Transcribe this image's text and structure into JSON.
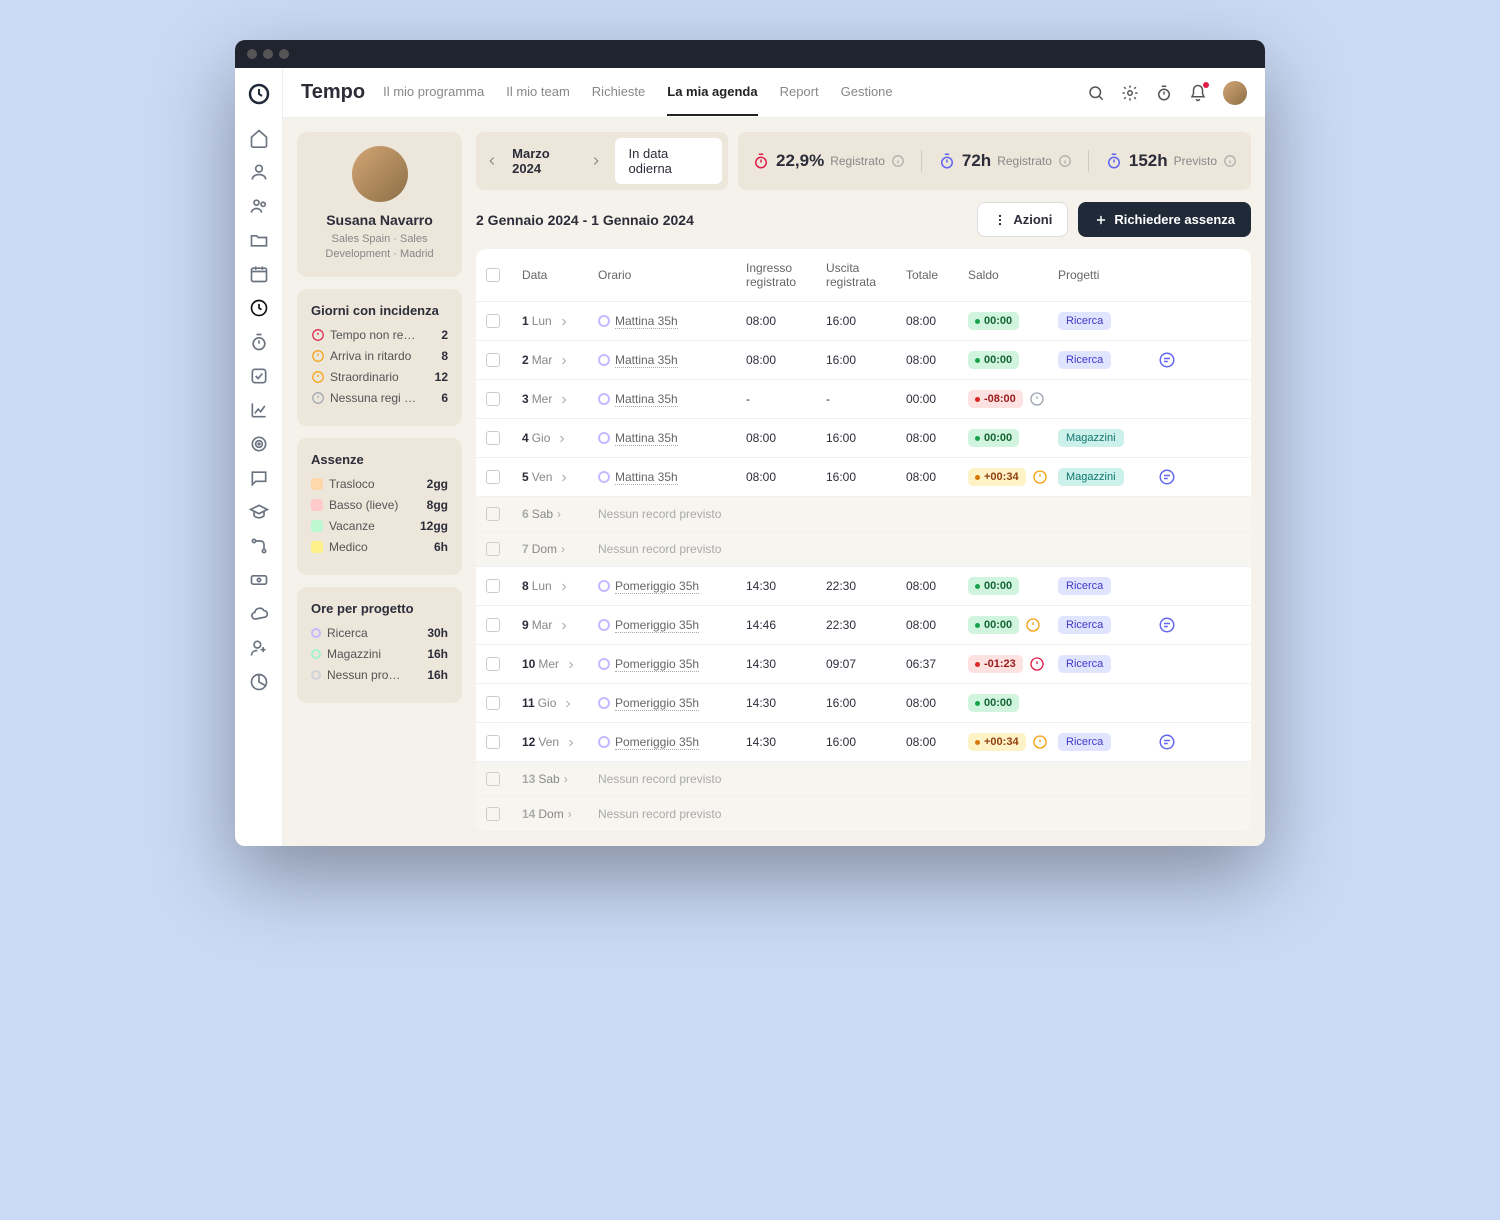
{
  "header": {
    "title": "Tempo",
    "tabs": [
      "Il mio programma",
      "Il mio team",
      "Richieste",
      "La mia agenda",
      "Report",
      "Gestione"
    ],
    "active_tab": 3
  },
  "date_nav": {
    "month": "Marzo 2024",
    "today_label": "In data odierna"
  },
  "metrics": [
    {
      "value": "22,9%",
      "label": "Registrato",
      "color": "#e11d48"
    },
    {
      "value": "72h",
      "label": "Registrato",
      "color": "#6366f1"
    },
    {
      "value": "152h",
      "label": "Previsto",
      "color": "#6366f1"
    }
  ],
  "range_title": "2 Gennaio 2024 - 1 Gennaio 2024",
  "actions": {
    "menu": "Azioni",
    "request": "Richiedere assenza"
  },
  "profile": {
    "name": "Susana Navarro",
    "subtitle": "Sales Spain · Sales Development  · Madrid"
  },
  "incidents": {
    "title": "Giorni con incidenza",
    "items": [
      {
        "label": "Tempo non re…",
        "value": "2",
        "color": "#e11d48"
      },
      {
        "label": "Arriva in ritardo",
        "value": "8",
        "color": "#f59e0b"
      },
      {
        "label": "Straordinario",
        "value": "12",
        "color": "#f59e0b"
      },
      {
        "label": "Nessuna regi …",
        "value": "6",
        "color": "#9ca3af"
      }
    ]
  },
  "absences": {
    "title": "Assenze",
    "items": [
      {
        "label": "Trasloco",
        "value": "2gg",
        "color": "#fed7aa"
      },
      {
        "label": "Basso (lieve)",
        "value": "8gg",
        "color": "#fecaca"
      },
      {
        "label": "Vacanze",
        "value": "12gg",
        "color": "#bbf7d0"
      },
      {
        "label": "Medico",
        "value": "6h",
        "color": "#fef08a"
      }
    ]
  },
  "projects": {
    "title": "Ore per progetto",
    "items": [
      {
        "label": "Ricerca",
        "value": "30h",
        "color": "#c7b9ff"
      },
      {
        "label": "Magazzini",
        "value": "16h",
        "color": "#a7f3d0"
      },
      {
        "label": "Nessun pro…",
        "value": "16h",
        "color": "#d1d5db"
      }
    ]
  },
  "table": {
    "headers": [
      "Data",
      "Orario",
      "Ingresso registrato",
      "Uscita registrata",
      "Totale",
      "Saldo",
      "Progetti"
    ],
    "no_record": "Nessun record previsto",
    "rows": [
      {
        "day": "1",
        "dow": "Lun",
        "shift": "Mattina 35h",
        "in": "08:00",
        "out": "16:00",
        "total": "08:00",
        "balance": "00:00",
        "btype": "g",
        "proj": "Ricerca",
        "pc": "purple"
      },
      {
        "day": "2",
        "dow": "Mar",
        "shift": "Mattina 35h",
        "in": "08:00",
        "out": "16:00",
        "total": "08:00",
        "balance": "00:00",
        "btype": "g",
        "proj": "Ricerca",
        "pc": "purple",
        "comment": true
      },
      {
        "day": "3",
        "dow": "Mer",
        "shift": "Mattina 35h",
        "in": "-",
        "out": "-",
        "total": "00:00",
        "balance": "-08:00",
        "btype": "r",
        "warn": "gray"
      },
      {
        "day": "4",
        "dow": "Gio",
        "shift": "Mattina 35h",
        "in": "08:00",
        "out": "16:00",
        "total": "08:00",
        "balance": "00:00",
        "btype": "g",
        "proj": "Magazzini",
        "pc": "teal"
      },
      {
        "day": "5",
        "dow": "Ven",
        "shift": "Mattina 35h",
        "in": "08:00",
        "out": "16:00",
        "total": "08:00",
        "balance": "+00:34",
        "btype": "y",
        "warn": "amber",
        "proj": "Magazzini",
        "pc": "teal",
        "comment": true
      },
      {
        "day": "6",
        "dow": "Sab",
        "muted": true
      },
      {
        "day": "7",
        "dow": "Dom",
        "muted": true
      },
      {
        "day": "8",
        "dow": "Lun",
        "shift": "Pomeriggio 35h",
        "in": "14:30",
        "out": "22:30",
        "total": "08:00",
        "balance": "00:00",
        "btype": "g",
        "proj": "Ricerca",
        "pc": "purple"
      },
      {
        "day": "9",
        "dow": "Mar",
        "shift": "Pomeriggio 35h",
        "in": "14:46",
        "out": "22:30",
        "total": "08:00",
        "balance": "00:00",
        "btype": "g",
        "warn": "amber",
        "proj": "Ricerca",
        "pc": "purple",
        "comment": true
      },
      {
        "day": "10",
        "dow": "Mer",
        "shift": "Pomeriggio 35h",
        "in": "14:30",
        "out": "09:07",
        "total": "06:37",
        "balance": "-01:23",
        "btype": "r",
        "warn": "red",
        "proj": "Ricerca",
        "pc": "purple"
      },
      {
        "day": "11",
        "dow": "Gio",
        "shift": "Pomeriggio 35h",
        "in": "14:30",
        "out": "16:00",
        "total": "08:00",
        "balance": "00:00",
        "btype": "g"
      },
      {
        "day": "12",
        "dow": "Ven",
        "shift": "Pomeriggio 35h",
        "in": "14:30",
        "out": "16:00",
        "total": "08:00",
        "balance": "+00:34",
        "btype": "y",
        "warn": "amber",
        "proj": "Ricerca",
        "pc": "purple",
        "comment": true
      },
      {
        "day": "13",
        "dow": "Sab",
        "muted": true
      },
      {
        "day": "14",
        "dow": "Dom",
        "muted": true
      }
    ]
  }
}
